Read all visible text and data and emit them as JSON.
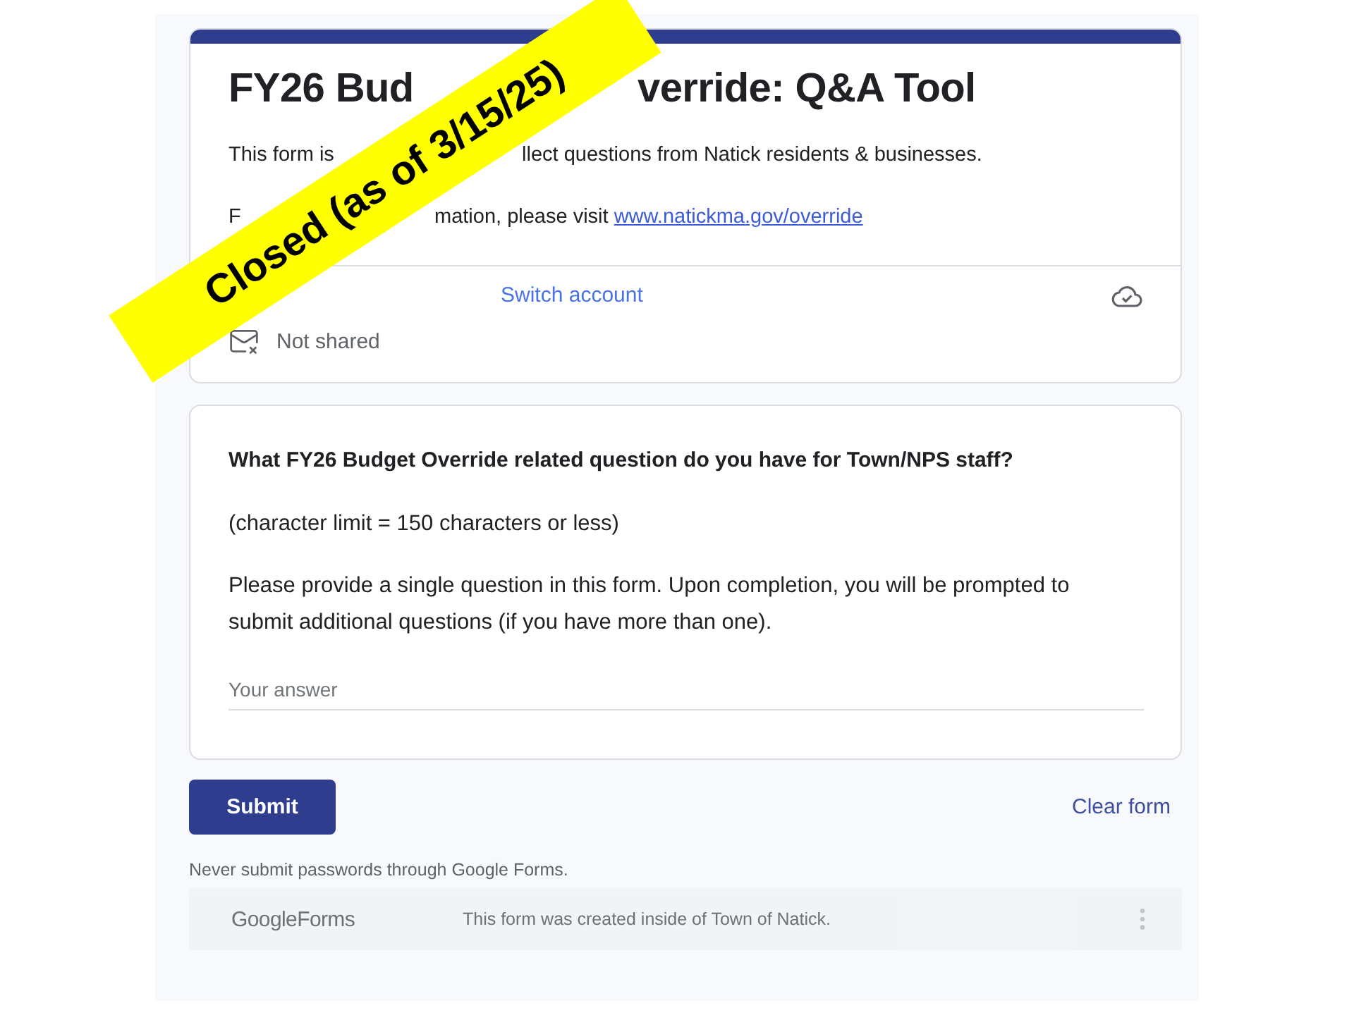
{
  "header": {
    "title_parts": [
      "FY26 Bud",
      "verride: Q&A Tool"
    ],
    "description_line_1": [
      "This form is",
      "llect questions from Natick residents & businesses."
    ],
    "description_line_2": [
      "F",
      "mation, please visit"
    ],
    "link": "www.natickma.gov/override",
    "switch_account": "Switch account",
    "sharing": "Not shared"
  },
  "banner": {
    "text": "Closed (as of 3/15/25)"
  },
  "question": {
    "title": "What FY26 Budget Override related question do you have for Town/NPS staff?",
    "paragraphs": [
      "(character limit = 150 characters or less)",
      "Please provide a single question in this form.  Upon completion, you will be prompted to submit additional questions (if you have more than one)."
    ],
    "placeholder": "Your answer"
  },
  "actions": {
    "submit": "Submit",
    "clear": "Clear form"
  },
  "warning": "Never submit passwords through Google Forms.",
  "footer": {
    "logo": [
      "Google",
      "Forms"
    ],
    "note": "This form was created inside of Town of Natick."
  }
}
